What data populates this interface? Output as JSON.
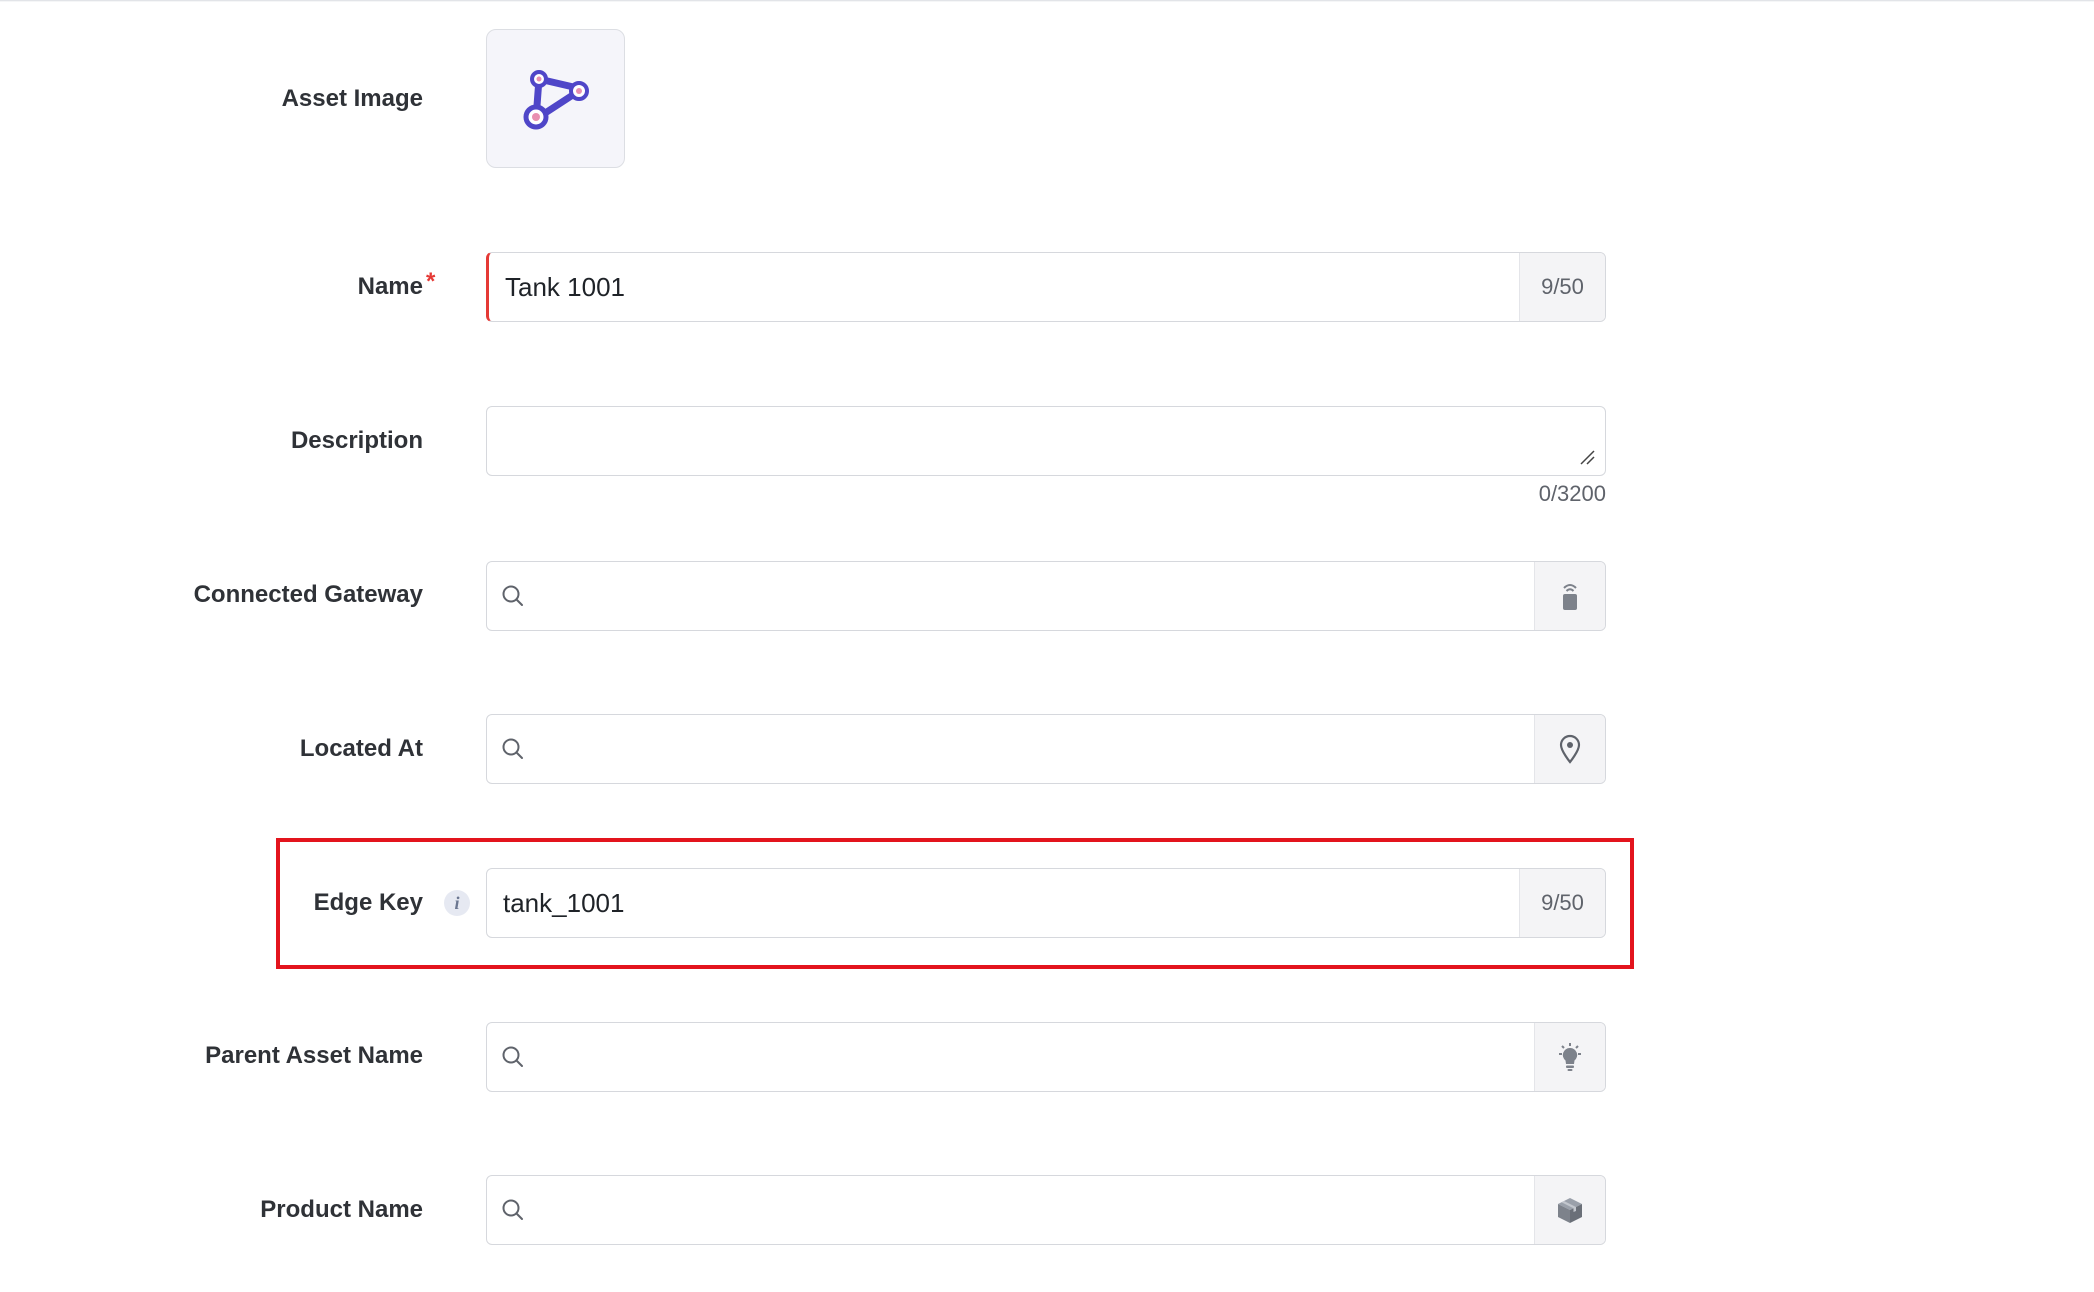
{
  "form": {
    "asset_image": {
      "label": "Asset Image",
      "icon": "conveyor-belt-icon"
    },
    "name": {
      "label": "Name",
      "required_mark": "*",
      "value": "Tank 1001",
      "counter": "9/50"
    },
    "description": {
      "label": "Description",
      "value": "",
      "counter": "0/3200"
    },
    "connected_gateway": {
      "label": "Connected Gateway",
      "value": "",
      "addon_icon": "gateway-icon"
    },
    "located_at": {
      "label": "Located At",
      "value": "",
      "addon_icon": "location-pin-icon"
    },
    "edge_key": {
      "label": "Edge Key",
      "info": "i",
      "value": "tank_1001",
      "counter": "9/50"
    },
    "parent_asset_name": {
      "label": "Parent Asset Name",
      "value": "",
      "addon_icon": "lightbulb-icon"
    },
    "product_name": {
      "label": "Product Name",
      "value": "",
      "addon_icon": "box-icon"
    }
  },
  "colors": {
    "accent": "#4f46c8",
    "error": "#e53935",
    "highlight": "#e3141d"
  }
}
